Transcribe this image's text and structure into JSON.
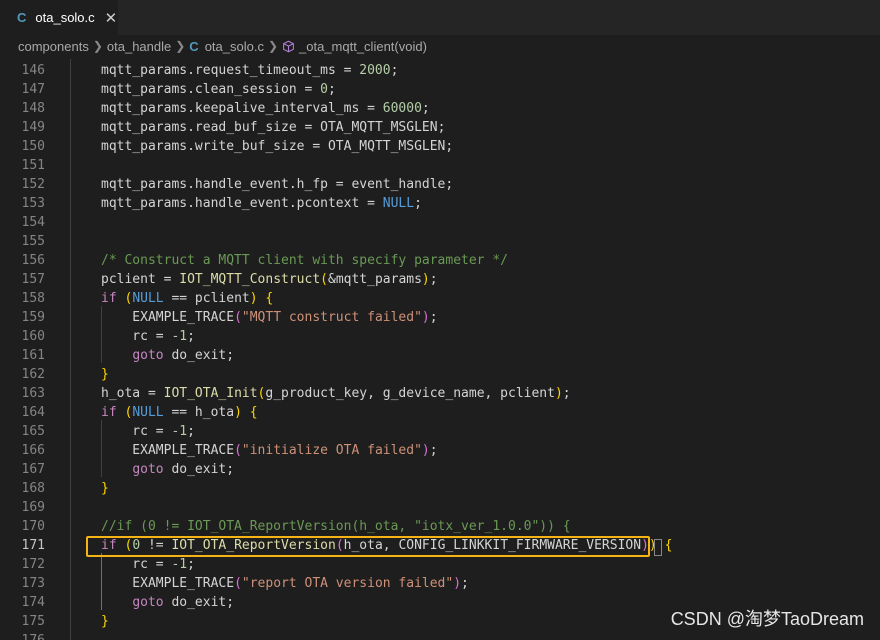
{
  "tab": {
    "icon": "C",
    "title": "ota_solo.c",
    "close": "✕"
  },
  "breadcrumb": {
    "items": [
      "components",
      "ota_handle",
      "ota_solo.c",
      "_ota_mqtt_client(void)"
    ],
    "file_icon": "C",
    "symbol_icon": "cube-icon"
  },
  "editor": {
    "active_line": 171,
    "lines": [
      {
        "n": "146",
        "tokens": [
          [
            "mqtt_params.request_timeout_ms = ",
            "var"
          ],
          [
            "2000",
            "num"
          ],
          [
            ";",
            "var"
          ]
        ]
      },
      {
        "n": "147",
        "tokens": [
          [
            "mqtt_params.clean_session = ",
            "var"
          ],
          [
            "0",
            "num"
          ],
          [
            ";",
            "var"
          ]
        ]
      },
      {
        "n": "148",
        "tokens": [
          [
            "mqtt_params.keepalive_interval_ms = ",
            "var"
          ],
          [
            "60000",
            "num"
          ],
          [
            ";",
            "var"
          ]
        ]
      },
      {
        "n": "149",
        "tokens": [
          [
            "mqtt_params.read_buf_size = ",
            "var"
          ],
          [
            "OTA_MQTT_MSGLEN",
            "mac"
          ],
          [
            ";",
            "var"
          ]
        ]
      },
      {
        "n": "150",
        "tokens": [
          [
            "mqtt_params.write_buf_size = ",
            "var"
          ],
          [
            "OTA_MQTT_MSGLEN",
            "mac"
          ],
          [
            ";",
            "var"
          ]
        ]
      },
      {
        "n": "151",
        "tokens": []
      },
      {
        "n": "152",
        "tokens": [
          [
            "mqtt_params.handle_event.h_fp = ",
            "var"
          ],
          [
            "event_handle",
            "var"
          ],
          [
            ";",
            "var"
          ]
        ]
      },
      {
        "n": "153",
        "tokens": [
          [
            "mqtt_params.handle_event.pcontext = ",
            "var"
          ],
          [
            "NULL",
            "kw"
          ],
          [
            ";",
            "var"
          ]
        ]
      },
      {
        "n": "154",
        "tokens": []
      },
      {
        "n": "155",
        "tokens": []
      },
      {
        "n": "156",
        "tokens": [
          [
            "/* Construct a MQTT client with specify parameter */",
            "cm"
          ]
        ]
      },
      {
        "n": "157",
        "tokens": [
          [
            "pclient = ",
            "var"
          ],
          [
            "IOT_MQTT_Construct",
            "fn"
          ],
          [
            "(",
            "p1"
          ],
          [
            "&mqtt_params",
            "var"
          ],
          [
            ")",
            "p1"
          ],
          [
            ";",
            "var"
          ]
        ]
      },
      {
        "n": "158",
        "tokens": [
          [
            "if",
            "ctl"
          ],
          [
            " ",
            "var"
          ],
          [
            "(",
            "p1"
          ],
          [
            "NULL",
            "kw"
          ],
          [
            " == pclient",
            "var"
          ],
          [
            ")",
            "p1"
          ],
          [
            " ",
            "var"
          ],
          [
            "{",
            "p1"
          ]
        ]
      },
      {
        "n": "159",
        "tokens": [
          [
            "    EXAMPLE_TRACE",
            "mac"
          ],
          [
            "(",
            "p2"
          ],
          [
            "\"MQTT construct failed\"",
            "str"
          ],
          [
            ")",
            "p2"
          ],
          [
            ";",
            "var"
          ]
        ]
      },
      {
        "n": "160",
        "tokens": [
          [
            "    rc = ",
            "var"
          ],
          [
            "-1",
            "num"
          ],
          [
            ";",
            "var"
          ]
        ]
      },
      {
        "n": "161",
        "tokens": [
          [
            "    ",
            "var"
          ],
          [
            "goto",
            "ctl"
          ],
          [
            " do_exit;",
            "var"
          ]
        ]
      },
      {
        "n": "162",
        "tokens": [
          [
            "}",
            "p1"
          ]
        ]
      },
      {
        "n": "163",
        "tokens": [
          [
            "h_ota = ",
            "var"
          ],
          [
            "IOT_OTA_Init",
            "fn"
          ],
          [
            "(",
            "p1"
          ],
          [
            "g_product_key, g_device_name, pclient",
            "var"
          ],
          [
            ")",
            "p1"
          ],
          [
            ";",
            "var"
          ]
        ]
      },
      {
        "n": "164",
        "tokens": [
          [
            "if",
            "ctl"
          ],
          [
            " ",
            "var"
          ],
          [
            "(",
            "p1"
          ],
          [
            "NULL",
            "kw"
          ],
          [
            " == h_ota",
            "var"
          ],
          [
            ")",
            "p1"
          ],
          [
            " ",
            "var"
          ],
          [
            "{",
            "p1"
          ]
        ]
      },
      {
        "n": "165",
        "tokens": [
          [
            "    rc = ",
            "var"
          ],
          [
            "-1",
            "num"
          ],
          [
            ";",
            "var"
          ]
        ]
      },
      {
        "n": "166",
        "tokens": [
          [
            "    EXAMPLE_TRACE",
            "mac"
          ],
          [
            "(",
            "p2"
          ],
          [
            "\"initialize OTA failed\"",
            "str"
          ],
          [
            ")",
            "p2"
          ],
          [
            ";",
            "var"
          ]
        ]
      },
      {
        "n": "167",
        "tokens": [
          [
            "    ",
            "var"
          ],
          [
            "goto",
            "ctl"
          ],
          [
            " do_exit;",
            "var"
          ]
        ]
      },
      {
        "n": "168",
        "tokens": [
          [
            "}",
            "p1"
          ]
        ]
      },
      {
        "n": "169",
        "tokens": []
      },
      {
        "n": "170",
        "tokens": [
          [
            "//if (0 != IOT_OTA_ReportVersion(h_ota, \"iotx_ver_1.0.0\")) {",
            "cm"
          ]
        ]
      },
      {
        "n": "171",
        "tokens": [
          [
            "if",
            "ctl"
          ],
          [
            " ",
            "var"
          ],
          [
            "(",
            "p1"
          ],
          [
            "0",
            "num"
          ],
          [
            " != ",
            "var"
          ],
          [
            "IOT_OTA_ReportVersion",
            "fn"
          ],
          [
            "(",
            "p2"
          ],
          [
            "h_ota, CONFIG_LINKKIT_FIRMWARE_VERSION",
            "mac"
          ],
          [
            ")",
            "p2"
          ],
          [
            ")",
            "p1"
          ],
          [
            " ",
            "var"
          ],
          [
            "{",
            "p1"
          ]
        ]
      },
      {
        "n": "172",
        "tokens": [
          [
            "    rc = ",
            "var"
          ],
          [
            "-1",
            "num"
          ],
          [
            ";",
            "var"
          ]
        ]
      },
      {
        "n": "173",
        "tokens": [
          [
            "    EXAMPLE_TRACE",
            "mac"
          ],
          [
            "(",
            "p2"
          ],
          [
            "\"report OTA version failed\"",
            "str"
          ],
          [
            ")",
            "p2"
          ],
          [
            ";",
            "var"
          ]
        ]
      },
      {
        "n": "174",
        "tokens": [
          [
            "    ",
            "var"
          ],
          [
            "goto",
            "ctl"
          ],
          [
            " do_exit;",
            "var"
          ]
        ]
      },
      {
        "n": "175",
        "tokens": [
          [
            "}",
            "p1"
          ]
        ]
      },
      {
        "n": "176",
        "tokens": []
      }
    ]
  },
  "watermark": "CSDN @淘梦TaoDream"
}
